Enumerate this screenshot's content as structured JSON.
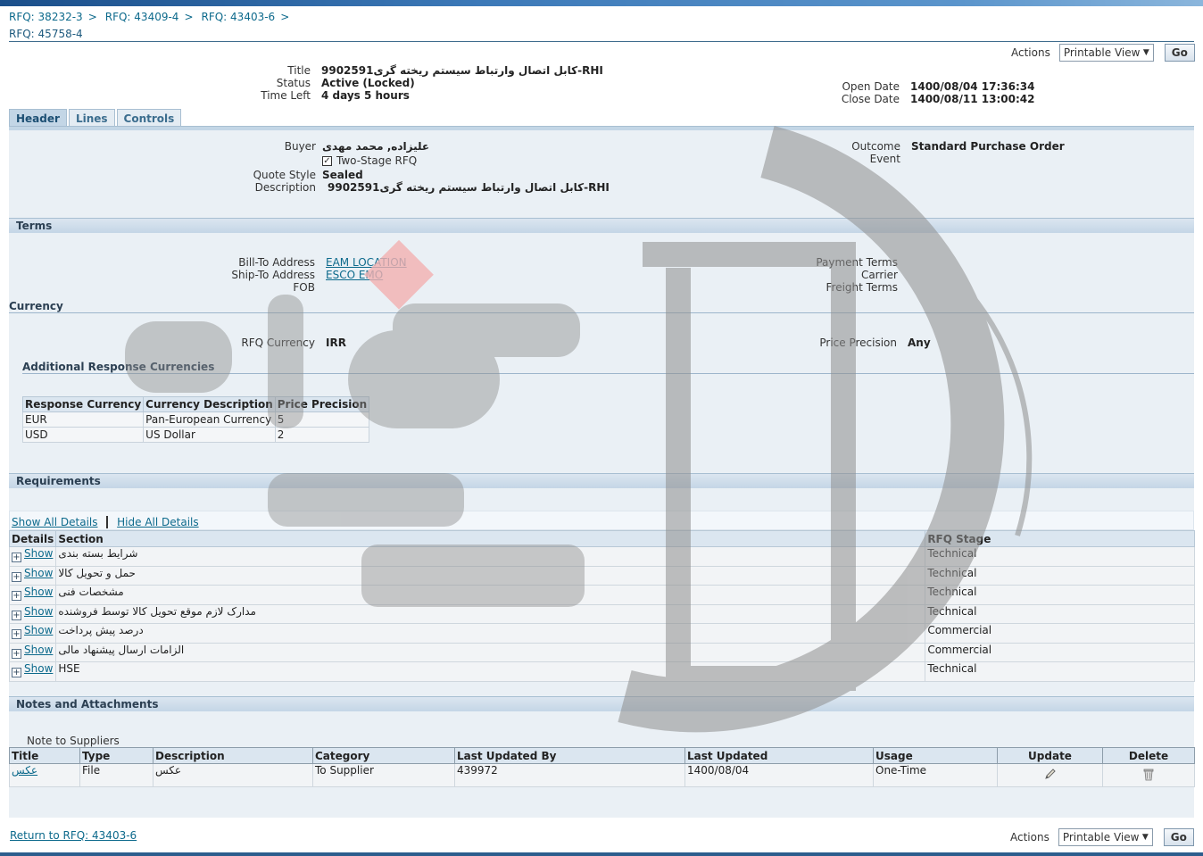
{
  "breadcrumbs": [
    "RFQ: 38232-3",
    "RFQ: 43409-4",
    "RFQ: 43403-6"
  ],
  "breadcrumb_separator": ">",
  "page_title": "RFQ: 45758-4",
  "actions": {
    "label": "Actions",
    "selected": "Printable View",
    "go": "Go"
  },
  "summary": {
    "title_label": "Title",
    "title_value": "کابل اتصال وارتباط سیستم ریخته گری9902591-RHI",
    "status_label": "Status",
    "status_value": "Active (Locked)",
    "time_left_label": "Time Left",
    "time_left_value": "4 days 5 hours",
    "open_date_label": "Open Date",
    "open_date_value": "1400/08/04 17:36:34",
    "close_date_label": "Close Date",
    "close_date_value": "1400/08/11 13:00:42"
  },
  "tabs": [
    "Header",
    "Lines",
    "Controls"
  ],
  "header": {
    "buyer_label": "Buyer",
    "buyer_value": "علیزاده, محمد مهدی",
    "two_stage_label": "Two-Stage RFQ",
    "two_stage_checked": true,
    "quote_style_label": "Quote Style",
    "quote_style_value": "Sealed",
    "description_label": "Description",
    "description_value": "کابل  اتصال وارتباط سیستم ریخته گری9902591-RHI",
    "outcome_label": "Outcome",
    "outcome_value": "Standard Purchase Order",
    "event_label": "Event"
  },
  "terms": {
    "heading": "Terms",
    "bill_to_label": "Bill-To Address",
    "bill_to_value": "EAM LOCATION",
    "ship_to_label": "Ship-To Address",
    "ship_to_value": "ESCO EMO",
    "fob_label": "FOB",
    "payment_terms_label": "Payment Terms",
    "carrier_label": "Carrier",
    "freight_terms_label": "Freight Terms"
  },
  "currency": {
    "heading": "Currency",
    "rfq_currency_label": "RFQ Currency",
    "rfq_currency_value": "IRR",
    "price_precision_label": "Price Precision",
    "price_precision_value": "Any",
    "additional_heading": "Additional Response Currencies",
    "columns": [
      "Response Currency",
      "Currency Description",
      "Price Precision"
    ],
    "rows": [
      [
        "EUR",
        "Pan-European Currency",
        "5"
      ],
      [
        "USD",
        "US Dollar",
        "2"
      ]
    ]
  },
  "requirements": {
    "heading": "Requirements",
    "show_all": "Show All Details",
    "hide_all": "Hide All Details",
    "columns": [
      "Details",
      "Section",
      "RFQ Stage"
    ],
    "show_label": "Show",
    "rows": [
      {
        "section": "شرایط بسته بندی",
        "stage": "Technical"
      },
      {
        "section": "حمل و تحویل کالا",
        "stage": "Technical"
      },
      {
        "section": "مشخصات فنی",
        "stage": "Technical"
      },
      {
        "section": "مدارک لازم موقع تحویل کالا توسط فروشنده",
        "stage": "Technical"
      },
      {
        "section": "درصد پیش پرداخت",
        "stage": "Commercial"
      },
      {
        "section": "الزامات ارسال پیشنهاد مالی",
        "stage": "Commercial"
      },
      {
        "section": "HSE",
        "stage": "Technical"
      }
    ]
  },
  "notes": {
    "heading": "Notes and Attachments",
    "note_to_suppliers": "Note to Suppliers",
    "columns": [
      "Title",
      "Type",
      "Description",
      "Category",
      "Last Updated By",
      "Last Updated",
      "Usage",
      "Update",
      "Delete"
    ],
    "rows": [
      {
        "title": "عکس",
        "type": "File",
        "description": "عکس",
        "category": "To Supplier",
        "updated_by": "439972",
        "updated": "1400/08/04",
        "usage": "One-Time"
      }
    ]
  },
  "return_link": "Return to RFQ: 43403-6",
  "icons": {
    "update": "pencil-icon",
    "delete": "trash-icon",
    "expand": "plus-box-icon",
    "checkbox": "checkbox-icon"
  }
}
